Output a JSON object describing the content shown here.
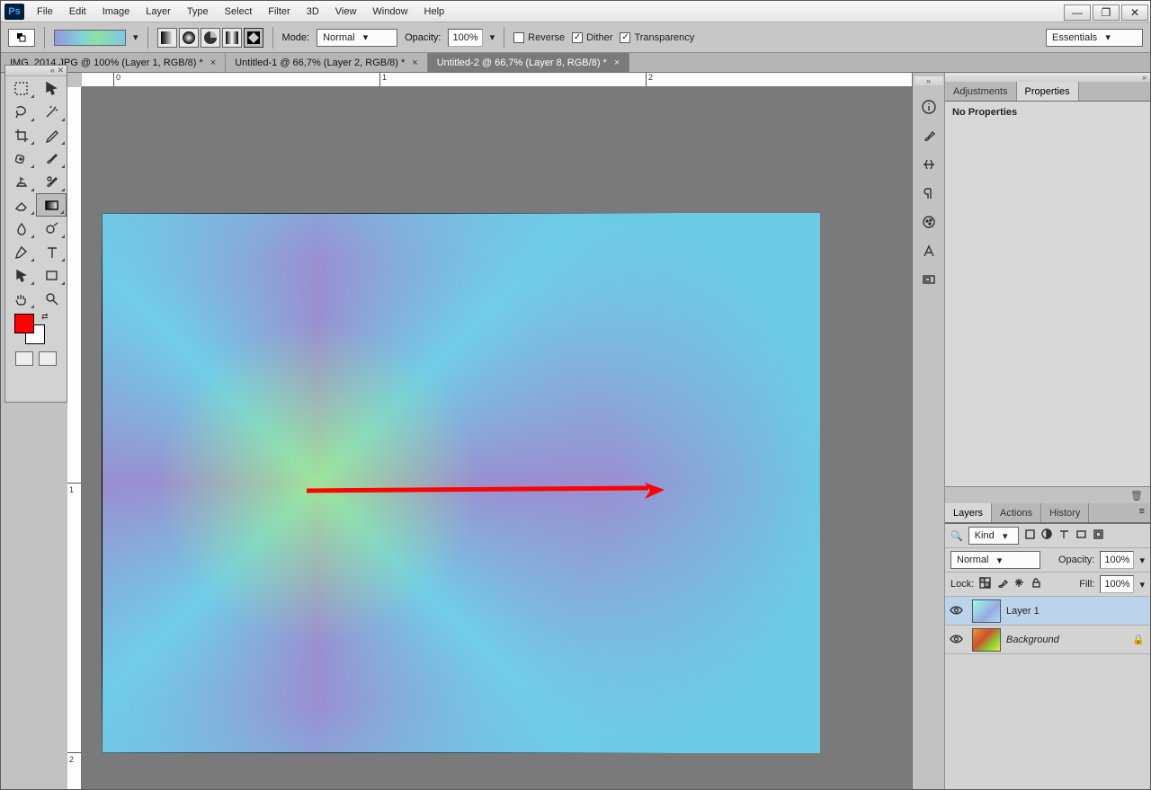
{
  "menu": {
    "items": [
      "File",
      "Edit",
      "Image",
      "Layer",
      "Type",
      "Select",
      "Filter",
      "3D",
      "View",
      "Window",
      "Help"
    ]
  },
  "options": {
    "mode_label": "Mode:",
    "mode_value": "Normal",
    "opacity_label": "Opacity:",
    "opacity_value": "100%",
    "reverse": "Reverse",
    "dither": "Dither",
    "transparency": "Transparency",
    "workspace": "Essentials"
  },
  "tabs": [
    "IMG_2014.JPG @ 100% (Layer 1, RGB/8) *",
    "Untitled-1 @ 66,7% (Layer 2, RGB/8) *",
    "Untitled-2 @ 66,7% (Layer 8, RGB/8) *"
  ],
  "ruler_h": [
    "0",
    "1",
    "2"
  ],
  "ruler_v": [
    "1",
    "2"
  ],
  "right": {
    "adjustments_tab": "Adjustments",
    "properties_tab": "Properties",
    "no_props": "No Properties",
    "layers_tab": "Layers",
    "actions_tab": "Actions",
    "history_tab": "History"
  },
  "layers_panel": {
    "filter_label": "Kind",
    "blend": "Normal",
    "opacity_label": "Opacity:",
    "opacity_value": "100%",
    "lock_label": "Lock:",
    "fill_label": "Fill:",
    "fill_value": "100%",
    "layer1": "Layer 1",
    "background": "Background"
  },
  "colors": {
    "fg": "#ff0101",
    "bg": "#ffffff"
  }
}
